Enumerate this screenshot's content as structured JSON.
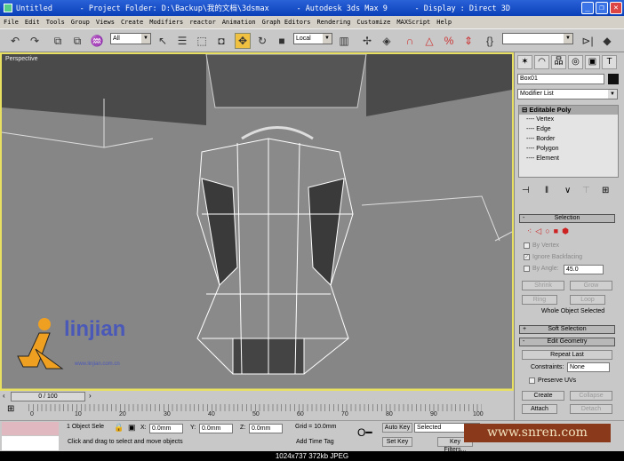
{
  "window": {
    "title": "Untitled      - Project Folder: D:\\Backup\\我的文档\\3dsmax      - Autodesk 3ds Max 9      - Display : Direct 3D"
  },
  "menu": [
    "File",
    "Edit",
    "Tools",
    "Group",
    "Views",
    "Create",
    "Modifiers",
    "reactor",
    "Animation",
    "Graph Editors",
    "Rendering",
    "Customize",
    "MAXScript",
    "Help"
  ],
  "toolbar": {
    "selection_filter": "All",
    "coord_system": "Local",
    "named_selection": ""
  },
  "viewport": {
    "label": "Perspective"
  },
  "logo": {
    "text": "linjian",
    "sub": "www.linjian.com.cn"
  },
  "command_panel": {
    "object_name": "Box01",
    "modifier_list": "Modifier List",
    "stack": {
      "title": "Editable Poly",
      "items": [
        "Vertex",
        "Edge",
        "Border",
        "Polygon",
        "Element"
      ]
    },
    "selection": {
      "title": "Selection",
      "by_vertex": "By Vertex",
      "ignore_backfacing": "Ignore Backfacing",
      "by_angle": "By Angle:",
      "angle": "45.0",
      "shrink": "Shrink",
      "grow": "Grow",
      "ring": "Ring",
      "loop": "Loop",
      "status": "Whole Object Selected"
    },
    "soft_selection": "Soft Selection",
    "edit_geometry": {
      "title": "Edit Geometry",
      "repeat_last": "Repeat Last",
      "constraints_label": "Constraints:",
      "constraints": "None",
      "preserve_uvs": "Preserve UVs",
      "create": "Create",
      "collapse": "Collapse",
      "attach": "Attach",
      "detach": "Detach"
    },
    "signs": {
      "minus": "-",
      "plus": "+"
    }
  },
  "timeline": {
    "frame": "0 / 100",
    "ticks": [
      "0",
      "10",
      "20",
      "30",
      "40",
      "50",
      "60",
      "70",
      "80",
      "90",
      "100"
    ]
  },
  "status": {
    "selection": "1 Object Sele",
    "x": "0.0mm",
    "y": "0.0mm",
    "z": "0.0mm",
    "x_label": "X:",
    "y_label": "Y:",
    "z_label": "Z:",
    "grid": "Grid = 10.0mm",
    "prompt": "Click and drag to select and move objects",
    "add_time_tag": "Add Time Tag",
    "auto_key": "Auto Key",
    "set_key": "Set Key",
    "key_mode": "Selected",
    "key_filters": "Key Filters..."
  },
  "watermark": "www.snren.com",
  "caption": "1024x737  372kb  JPEG"
}
